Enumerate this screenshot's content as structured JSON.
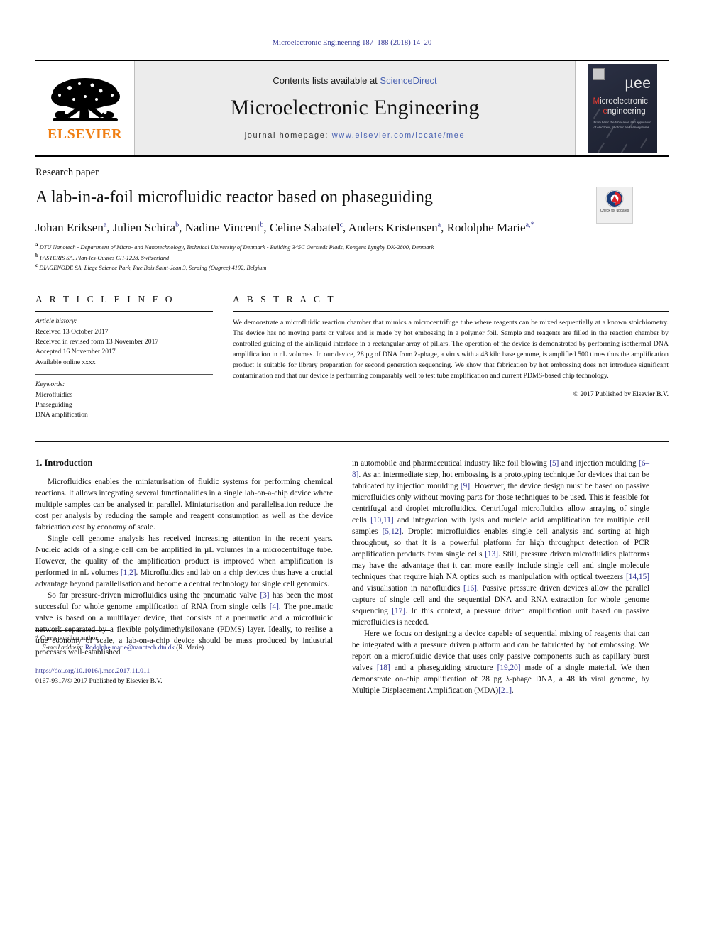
{
  "running_head": "Microelectronic Engineering 187–188 (2018) 14–20",
  "masthead": {
    "publisher_name": "ELSEVIER",
    "contents_prefix": "Contents lists available at ",
    "sciencedirect": "ScienceDirect",
    "journal_name": "Microelectronic Engineering",
    "homepage_prefix": "journal homepage: ",
    "homepage_url": "www.elsevier.com/locate/mee",
    "cover": {
      "mue": "µee",
      "line1_red": "M",
      "line1_rest": "icroelectronic",
      "line2_red": "e",
      "line2_rest": "ngineering",
      "subtitle": "From basic the fabrication and application of electronic, photonic and nanosystems"
    }
  },
  "article": {
    "type_label": "Research paper",
    "title": "A lab-in-a-foil microfluidic reactor based on phaseguiding",
    "crossmark_label": "Check for updates",
    "authors_html": "Johan Eriksen<sup>a</sup>, Julien Schira<sup>b</sup>, Nadine Vincent<sup>b</sup>, Celine Sabatel<sup>c</sup>, Anders Kristensen<sup>a</sup>, Rodolphe Marie<sup>a,<span class=\"star\">*</span></sup>",
    "affiliations": [
      {
        "marker": "a",
        "text": "DTU Nanotech - Department of Micro- and Nanotechnology, Technical University of Denmark - Building 345C Oersteds Plads, Kongens Lyngby DK-2800, Denmark"
      },
      {
        "marker": "b",
        "text": "FASTERIS SA, Plan-les-Ouates CH-1228, Switzerland"
      },
      {
        "marker": "c",
        "text": "DIAGENODE SA, Liege Science Park, Rue Bois Saint-Jean 3, Seraing (Ougree) 4102, Belgium"
      }
    ]
  },
  "article_info": {
    "heading": "A R T I C L E   I N F O",
    "history_label": "Article history:",
    "history": [
      "Received 13 October 2017",
      "Received in revised form 13 November 2017",
      "Accepted 16 November 2017",
      "Available online xxxx"
    ],
    "keywords_label": "Keywords:",
    "keywords": [
      "Microfluidics",
      "Phaseguiding",
      "DNA amplification"
    ]
  },
  "abstract": {
    "heading": "A B S T R A C T",
    "text": "We demonstrate a microfluidic reaction chamber that mimics a microcentrifuge tube where reagents can be mixed sequentially at a known stoichiometry. The device has no moving parts or valves and is made by hot embossing in a polymer foil. Sample and reagents are filled in the reaction chamber by controlled guiding of the air/liquid interface in a rectangular array of pillars. The operation of the device is demonstrated by performing isothermal DNA amplification in nL volumes. In our device, 28 pg of DNA from λ-phage, a virus with a 48 kilo base genome, is amplified 500 times thus the amplification product is suitable for library preparation for second generation sequencing. We show that fabrication by hot embossing does not introduce significant contamination and that our device is performing comparably well to test tube amplification and current PDMS-based chip technology.",
    "copyright": "© 2017 Published by Elsevier B.V."
  },
  "body": {
    "section_number_title": "1. Introduction",
    "left_paragraphs": [
      "Microfluidics enables the miniaturisation of fluidic systems for performing chemical reactions. It allows integrating several functionalities in a single lab-on-a-chip device where multiple samples can be analysed in parallel. Miniaturisation and parallelisation reduce the cost per analysis by reducing the sample and reagent consumption as well as the device fabrication cost by economy of scale.",
      "Single cell genome analysis has received increasing attention in the recent years. Nucleic acids of a single cell can be amplified in µL volumes in a microcentrifuge tube. However, the quality of the amplification product is improved when amplification is performed in nL volumes [1,2]. Microfluidics and lab on a chip devices thus have a crucial advantage beyond parallelisation and become a central technology for single cell genomics.",
      "So far pressure-driven microfluidics using the pneumatic valve [3] has been the most successful for whole genome amplification of RNA from single cells [4]. The pneumatic valve is based on a multilayer device, that consists of a pneumatic and a microfluidic network separated by a flexible polydimethylsiloxane (PDMS) layer. Ideally, to realise a true economy of scale, a lab-on-a-chip device should be mass produced by industrial processes well-established"
    ],
    "right_paragraphs": [
      "in automobile and pharmaceutical industry like foil blowing [5] and injection moulding [6–8]. As an intermediate step, hot embossing is a prototyping technique for devices that can be fabricated by injection moulding [9]. However, the device design must be based on passive microfluidics only without moving parts for those techniques to be used. This is feasible for centrifugal and droplet microfluidics. Centrifugal microfluidics allow arraying of single cells [10,11] and integration with lysis and nucleic acid amplification for multiple cell samples [5,12]. Droplet microfluidics enables single cell analysis and sorting at high throughput, so that it is a powerful platform for high throughput detection of PCR amplification products from single cells [13]. Still, pressure driven microfluidics platforms may have the advantage that it can more easily include single cell and single molecule techniques that require high NA optics such as manipulation with optical tweezers [14,15] and visualisation in nanofluidics [16]. Passive pressure driven devices allow the parallel capture of single cell and the sequential DNA and RNA extraction for whole genome sequencing [17]. In this context, a pressure driven amplification unit based on passive microfluidics is needed.",
      "Here we focus on designing a device capable of sequential mixing of reagents that can be integrated with a pressure driven platform and can be fabricated by hot embossing. We report on a microfluidic device that uses only passive components such as capillary burst valves [18] and a phaseguiding structure [19,20] made of a single material. We then demonstrate on-chip amplification of 28 pg λ-phage DNA, a 48 kb viral genome, by Multiple Displacement Amplification (MDA)[21]."
    ]
  },
  "footer": {
    "corresponding_marker": "*",
    "corresponding_label": "Corresponding author.",
    "email_label": "E-mail address:",
    "email": "Rodolphe.marie@nanotech.dtu.dk",
    "email_suffix": "(R. Marie).",
    "doi": "https://doi.org/10.1016/j.mee.2017.11.011",
    "issn_line": "0167-9317/© 2017 Published by Elsevier B.V."
  },
  "colors": {
    "link": "#2e3191",
    "elsevier_orange": "#f07f13",
    "masthead_bg": "#ececec"
  }
}
